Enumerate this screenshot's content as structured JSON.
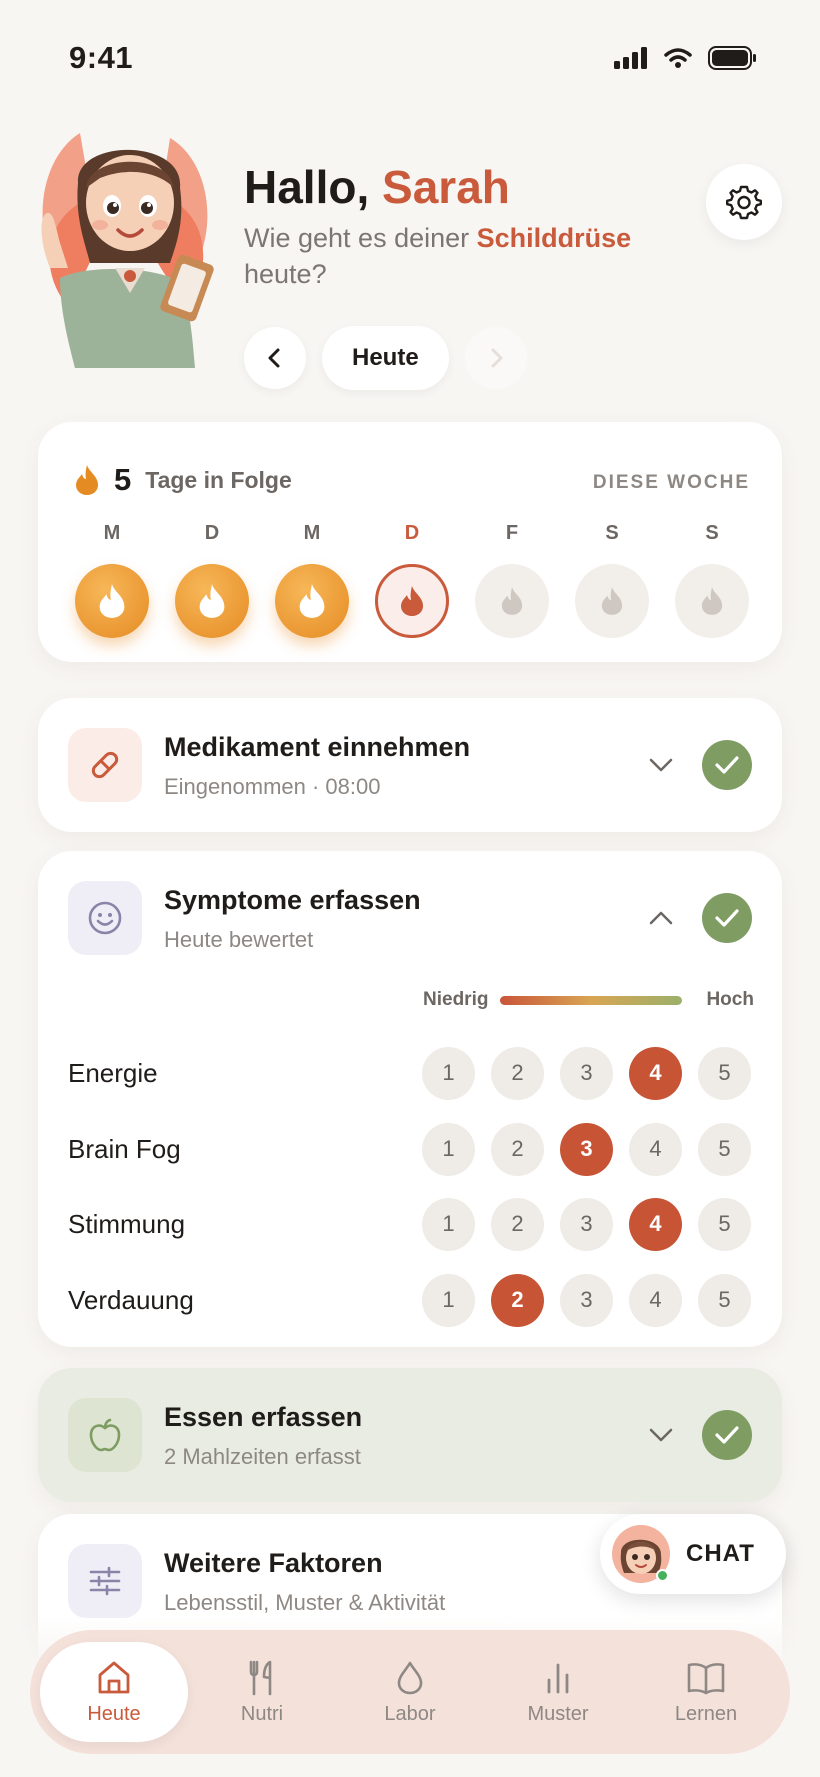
{
  "status_bar": {
    "time": "9:41"
  },
  "header": {
    "greeting_prefix": "Hallo,",
    "user_name": "Sarah",
    "subtitle_before": "Wie geht es deiner",
    "subtitle_highlight": "Schilddrüse",
    "subtitle_after": "heute?",
    "date_label": "Heute"
  },
  "streak": {
    "count": "5",
    "label": "Tage in Folge",
    "week_label": "DIESE WOCHE",
    "days": [
      {
        "letter": "M",
        "state": "done"
      },
      {
        "letter": "D",
        "state": "done"
      },
      {
        "letter": "M",
        "state": "done"
      },
      {
        "letter": "D",
        "state": "today"
      },
      {
        "letter": "F",
        "state": "future"
      },
      {
        "letter": "S",
        "state": "future"
      },
      {
        "letter": "S",
        "state": "future"
      }
    ]
  },
  "tasks": {
    "medication": {
      "title": "Medikament einnehmen",
      "subtitle": "Eingenommen · 08:00",
      "done": true
    },
    "symptoms": {
      "title": "Symptome erfassen",
      "subtitle": "Heute bewertet",
      "done": true
    },
    "food": {
      "title": "Essen erfassen",
      "subtitle": "2 Mahlzeiten erfasst",
      "done": true
    },
    "factors": {
      "title": "Weitere Faktoren",
      "subtitle": "Lebensstil, Muster & Aktivität"
    }
  },
  "scale": {
    "low": "Niedrig",
    "high": "Hoch",
    "options": [
      "1",
      "2",
      "3",
      "4",
      "5"
    ]
  },
  "symptoms": [
    {
      "label": "Energie",
      "value": 4
    },
    {
      "label": "Brain Fog",
      "value": 3
    },
    {
      "label": "Stimmung",
      "value": 4
    },
    {
      "label": "Verdauung",
      "value": 2
    }
  ],
  "chat": {
    "label": "CHAT"
  },
  "nav": {
    "items": [
      {
        "label": "Heute",
        "icon": "home-icon",
        "active": true
      },
      {
        "label": "Nutri",
        "icon": "fork-knife-icon",
        "active": false
      },
      {
        "label": "Labor",
        "icon": "drop-icon",
        "active": false
      },
      {
        "label": "Muster",
        "icon": "bar-chart-icon",
        "active": false
      },
      {
        "label": "Lernen",
        "icon": "book-icon",
        "active": false
      }
    ]
  },
  "colors": {
    "accent": "#c95a3b",
    "streak": "#e58b23",
    "success": "#7f9d63",
    "nav_bg": "#f4e1da"
  }
}
